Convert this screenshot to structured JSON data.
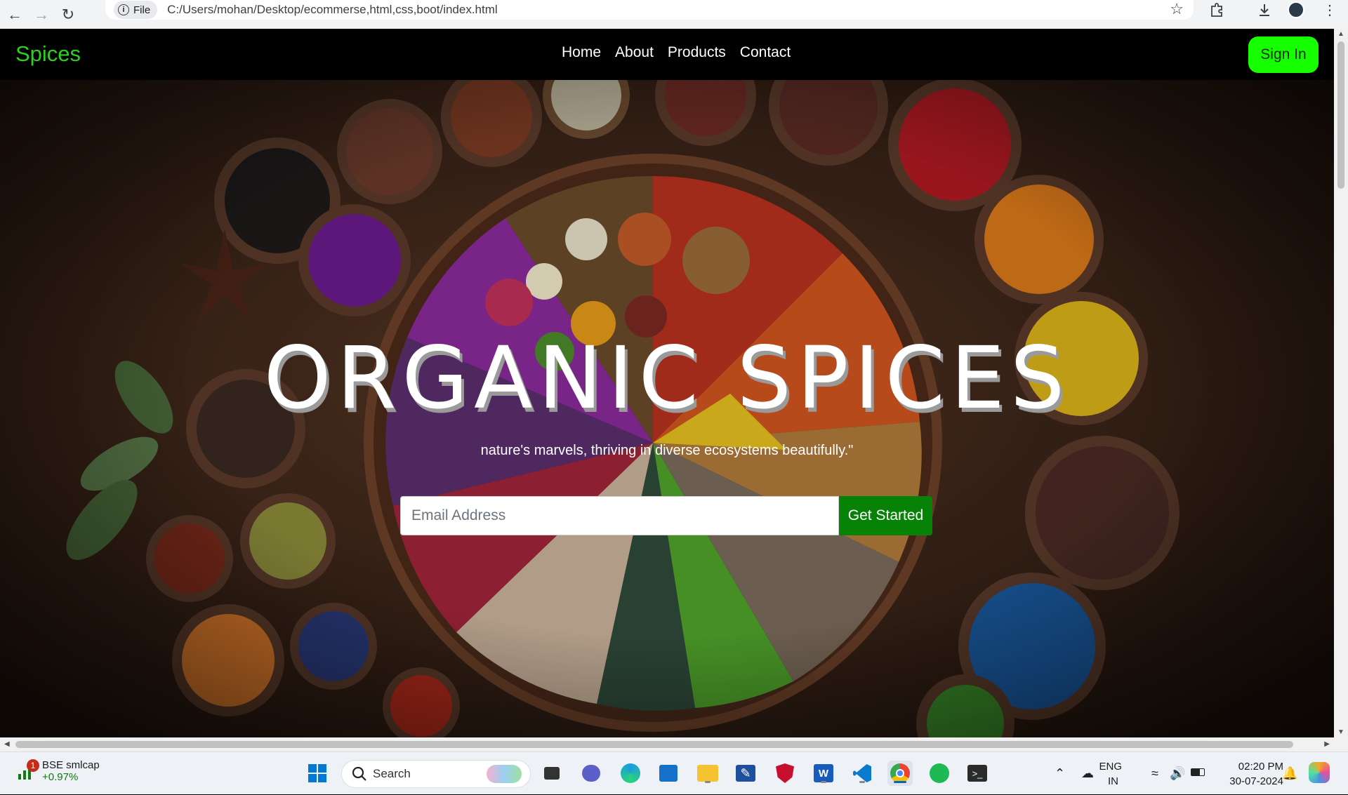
{
  "browser": {
    "file_chip": "File",
    "url": "C:/Users/mohan/Desktop/ecommerse,html,css,boot/index.html"
  },
  "site": {
    "brand": "Spices",
    "nav": [
      "Home",
      "About",
      "Products",
      "Contact"
    ],
    "signin_label": "Sign In",
    "hero_title": "ORGANIC SPICES",
    "hero_subtitle": "nature's marvels, thriving in diverse ecosystems beautifully.\"",
    "email_placeholder": "Email Address",
    "cta_label": "Get Started",
    "colors": {
      "brand": "#2bd11b",
      "signin_bg": "#15ff00",
      "cta_bg": "#068306"
    }
  },
  "taskbar": {
    "widget_name": "BSE smlcap",
    "widget_change": "+0.97%",
    "widget_badge": "1",
    "search_label": "Search",
    "lang_top": "ENG",
    "lang_bottom": "IN",
    "time": "02:20 PM",
    "date": "30-07-2024"
  }
}
